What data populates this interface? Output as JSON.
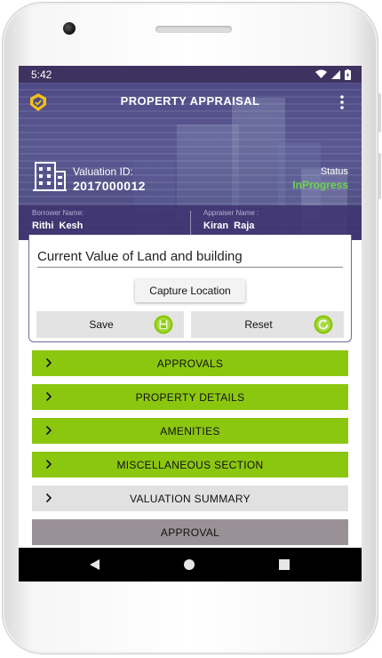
{
  "status_bar": {
    "time": "5:42"
  },
  "header": {
    "title": "PROPERTY APPRAISAL",
    "valuation_label": "Valuation ID:",
    "valuation_id": "2017000012",
    "status_label": "Status",
    "status_value": "InProgress",
    "status_color": "#6cd64a",
    "borrower_label": "Borrower Name:",
    "borrower_name": "Rithi  Kesh",
    "appraiser_label": "Appraiser Name :",
    "appraiser_name": "Kiran  Raja"
  },
  "form": {
    "field_value": "Current Value of Land and building",
    "capture_label": "Capture Location",
    "save_label": "Save",
    "reset_label": "Reset"
  },
  "sections": [
    {
      "label": "APPROVALS",
      "color": "#8cc710"
    },
    {
      "label": "PROPERTY DETAILS",
      "color": "#8cc710"
    },
    {
      "label": "AMENITIES",
      "color": "#8cc710"
    },
    {
      "label": "MISCELLANEOUS SECTION",
      "color": "#8cc710"
    },
    {
      "label": "VALUATION SUMMARY",
      "color": "#e1e1e1"
    },
    {
      "label": "APPROVAL",
      "color": "#9a9196"
    }
  ],
  "icons": {
    "app_logo": "shield-check-icon",
    "menu": "kebab-menu-icon",
    "valuation": "building-icon",
    "save": "save-circle-icon",
    "reset": "refresh-circle-icon",
    "section": "chevron-right-icon"
  },
  "colors": {
    "accent_green": "#8cc710",
    "header_purple": "#4e4a86",
    "dark_purple": "#3e3360"
  }
}
